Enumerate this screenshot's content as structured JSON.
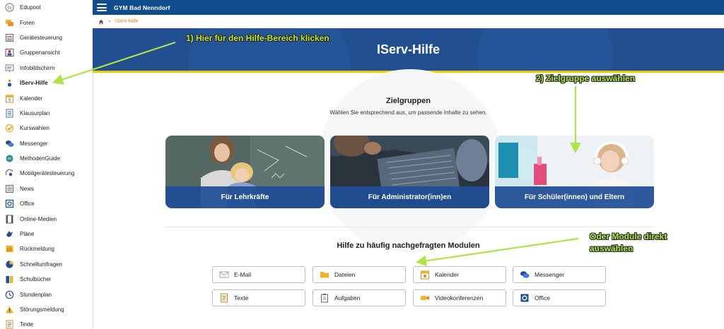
{
  "sidebar": {
    "items": [
      {
        "label": "Edupool",
        "icon": "edupool-icon"
      },
      {
        "label": "Foren",
        "icon": "forum-icon"
      },
      {
        "label": "Gerätesteuerung",
        "icon": "device-control-icon"
      },
      {
        "label": "Gruppenansicht",
        "icon": "group-view-icon"
      },
      {
        "label": "Infobildschirm",
        "icon": "info-screen-icon"
      },
      {
        "label": "IServ-Hilfe",
        "icon": "help-icon",
        "active": true
      },
      {
        "label": "Kalender",
        "icon": "calendar-icon"
      },
      {
        "label": "Klausurplan",
        "icon": "exam-plan-icon"
      },
      {
        "label": "Kurswahlen",
        "icon": "course-choice-icon"
      },
      {
        "label": "Messenger",
        "icon": "messenger-icon"
      },
      {
        "label": "MethodenGuide",
        "icon": "methods-guide-icon"
      },
      {
        "label": "Mobilgerätesteuerung",
        "icon": "mobile-device-icon"
      },
      {
        "label": "News",
        "icon": "news-icon"
      },
      {
        "label": "Office",
        "icon": "office-icon"
      },
      {
        "label": "Online-Medien",
        "icon": "online-media-icon"
      },
      {
        "label": "Pläne",
        "icon": "plans-icon"
      },
      {
        "label": "Rückmeldung",
        "icon": "feedback-icon"
      },
      {
        "label": "Schnellumfragen",
        "icon": "quick-survey-icon"
      },
      {
        "label": "Schulbücher",
        "icon": "schoolbooks-icon"
      },
      {
        "label": "Stundenplan",
        "icon": "timetable-icon"
      },
      {
        "label": "Störungsmeldung",
        "icon": "fault-report-icon"
      },
      {
        "label": "Texte",
        "icon": "texts-icon"
      }
    ]
  },
  "topbar": {
    "title": "GYM Bad Nenndorf",
    "menu_icon": "hamburger-menu-icon"
  },
  "breadcrumb": {
    "home_icon": "home-icon",
    "separator": "»",
    "current": "IServ-Hilfe"
  },
  "hero": {
    "title": "IServ-Hilfe",
    "accent_color": "#f3c700",
    "background_color": "#214f91"
  },
  "target_groups": {
    "title": "Zielgruppen",
    "subtitle": "Wählen Sie entsprechend aus, um passende Inhalte zu sehen.",
    "cards": [
      {
        "label": "Für Lehrkräfte"
      },
      {
        "label": "Für Administrator(inn)en"
      },
      {
        "label": "Für Schüler(innen) und Eltern"
      }
    ]
  },
  "modules": {
    "title": "Hilfe zu häufig nachgefragten Modulen",
    "buttons": [
      {
        "label": "E-Mail",
        "icon": "mail-icon"
      },
      {
        "label": "Dateien",
        "icon": "folder-icon"
      },
      {
        "label": "Kalender",
        "icon": "calendar-icon"
      },
      {
        "label": "Messenger",
        "icon": "messenger-icon"
      },
      {
        "label": "Texte",
        "icon": "texts-icon"
      },
      {
        "label": "Aufgaben",
        "icon": "tasks-icon"
      },
      {
        "label": "Videokonferenzen",
        "icon": "video-conference-icon"
      },
      {
        "label": "Office",
        "icon": "office-icon"
      }
    ]
  },
  "annotations": {
    "step1": "1) Hier für den Hilfe-Bereich klicken",
    "step2": "2) Zielgruppe auswählen",
    "step3_line1": "Oder Module direkt",
    "step3_line2": "auswählen",
    "color": "#aee346"
  }
}
